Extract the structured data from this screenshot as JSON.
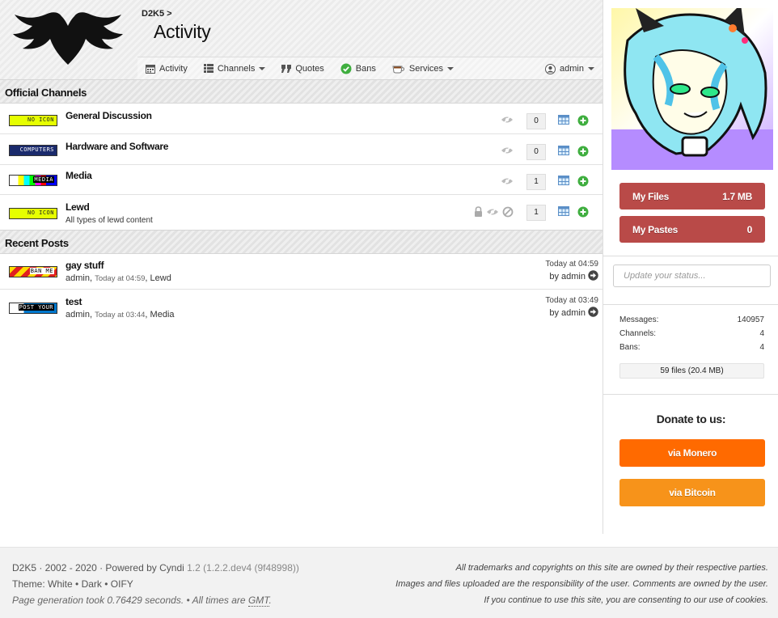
{
  "header": {
    "breadcrumb": "D2K5 >",
    "title": "Activity"
  },
  "nav": {
    "activity": "Activity",
    "channels": "Channels",
    "quotes": "Quotes",
    "bans": "Bans",
    "services": "Services",
    "user": "admin"
  },
  "official_channels": {
    "heading": "Official Channels",
    "items": [
      {
        "name": "General Discussion",
        "description": "",
        "count": "0",
        "icon_text": "NO ICON",
        "icon_color": "#e6ff00"
      },
      {
        "name": "Hardware and Software",
        "description": "",
        "count": "0",
        "icon_text": "COMPUTERS",
        "icon_color": "#1a2a6c"
      },
      {
        "name": "Media",
        "description": "",
        "count": "1",
        "icon_text": "MEDIA",
        "icon_color": "#ffffff"
      },
      {
        "name": "Lewd",
        "description": "All types of lewd content",
        "count": "1",
        "icon_text": "NO ICON",
        "icon_color": "#e6ff00"
      }
    ]
  },
  "recent_posts": {
    "heading": "Recent Posts",
    "items": [
      {
        "title": "gay stuff",
        "author": "admin",
        "time": "Today at 04:59",
        "channel": "Lewd",
        "right_time": "Today at 04:59",
        "by_label": "by",
        "by_user": "admin",
        "icon_text": "BAN ME"
      },
      {
        "title": "test",
        "author": "admin",
        "time": "Today at 03:44",
        "channel": "Media",
        "right_time": "Today at 03:49",
        "by_label": "by",
        "by_user": "admin",
        "icon_text": "POST YOUR"
      }
    ]
  },
  "sidebar": {
    "my_files_label": "My Files",
    "my_files_value": "1.7 MB",
    "my_pastes_label": "My Pastes",
    "my_pastes_value": "0",
    "status_placeholder": "Update your status...",
    "stats": {
      "messages_label": "Messages:",
      "messages_value": "140957",
      "channels_label": "Channels:",
      "channels_value": "4",
      "bans_label": "Bans:",
      "bans_value": "4"
    },
    "files_summary": "59 files (20.4 MB)",
    "donate_title": "Donate to us:",
    "donate_monero": "via Monero",
    "donate_bitcoin": "via Bitcoin"
  },
  "footer": {
    "line1": "D2K5 · 2002 - 2020 · Powered by Cyndi ",
    "version": "1.2 (1.2.2.dev4 (9f48998))",
    "theme_label": "Theme: ",
    "themes": [
      "White",
      "Dark",
      "OIFY"
    ],
    "gen_prefix": "Page generation took 0.76429 seconds. • All times are ",
    "tz": "GMT",
    "gen_suffix": ".",
    "right1": "All trademarks and copyrights on this site are owned by their respective parties.",
    "right2": "Images and files uploaded are the responsibility of the user. Comments are owned by the user.",
    "right3": "If you continue to use this site, you are consenting to our use of cookies."
  },
  "colors": {
    "files_button": "#b94a48",
    "monero": "#ff6a00",
    "bitcoin": "#f7931a",
    "add_green": "#3fae3f"
  },
  "icons": [
    "logo-wings",
    "calendar-icon",
    "list-icon",
    "quote-icon",
    "check-circle-icon",
    "coffee-icon",
    "user-circle-icon",
    "eye-slash-icon",
    "lock-icon",
    "ban-icon",
    "table-icon",
    "plus-circle-icon",
    "arrow-circle-right-icon"
  ]
}
